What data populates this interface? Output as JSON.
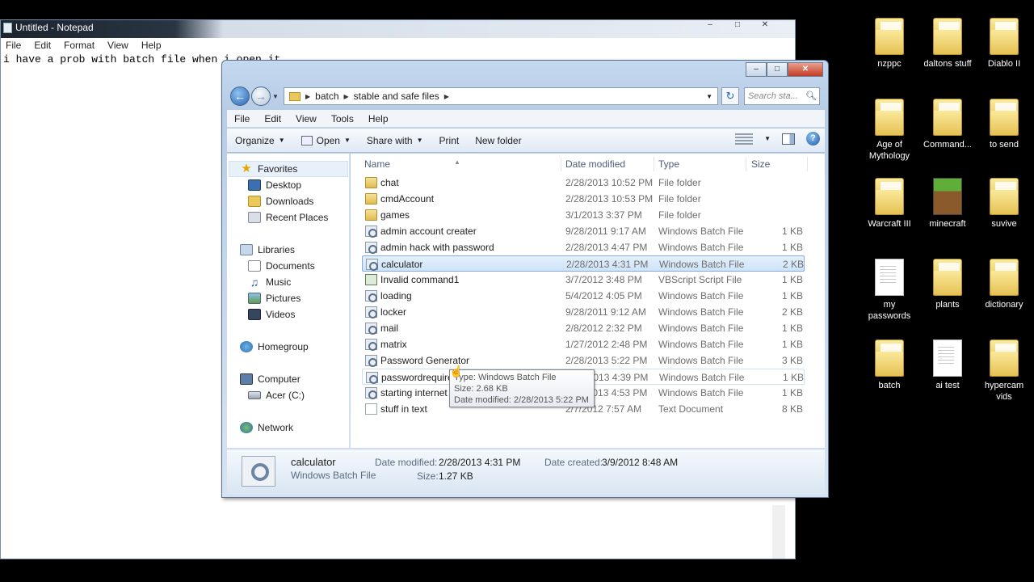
{
  "notepad": {
    "title": "Untitled - Notepad",
    "menu": [
      "File",
      "Edit",
      "Format",
      "View",
      "Help"
    ],
    "text": "i have a prob with batch file when i open it"
  },
  "explorer": {
    "address": {
      "crumbs": [
        "batch",
        "stable and safe files"
      ]
    },
    "search_placeholder": "Search sta...",
    "menu": [
      "File",
      "Edit",
      "View",
      "Tools",
      "Help"
    ],
    "toolbar": {
      "organize": "Organize",
      "open": "Open",
      "share": "Share with",
      "print": "Print",
      "new_folder": "New folder"
    },
    "nav": {
      "favorites": "Favorites",
      "desktop": "Desktop",
      "downloads": "Downloads",
      "recent": "Recent Places",
      "libraries": "Libraries",
      "documents": "Documents",
      "music": "Music",
      "pictures": "Pictures",
      "videos": "Videos",
      "homegroup": "Homegroup",
      "computer": "Computer",
      "acer": "Acer (C:)",
      "network": "Network"
    },
    "columns": {
      "name": "Name",
      "date": "Date modified",
      "type": "Type",
      "size": "Size"
    },
    "files": [
      {
        "name": "chat",
        "date": "2/28/2013 10:52 PM",
        "type": "File folder",
        "size": "",
        "kind": "folder"
      },
      {
        "name": "cmdAccount",
        "date": "2/28/2013 10:53 PM",
        "type": "File folder",
        "size": "",
        "kind": "folder"
      },
      {
        "name": "games",
        "date": "3/1/2013 3:37 PM",
        "type": "File folder",
        "size": "",
        "kind": "folder"
      },
      {
        "name": "admin account creater",
        "date": "9/28/2011 9:17 AM",
        "type": "Windows Batch File",
        "size": "1 KB",
        "kind": "bat"
      },
      {
        "name": "admin hack with password",
        "date": "2/28/2013 4:47 PM",
        "type": "Windows Batch File",
        "size": "1 KB",
        "kind": "bat"
      },
      {
        "name": "calculator",
        "date": "2/28/2013 4:31 PM",
        "type": "Windows Batch File",
        "size": "2 KB",
        "kind": "bat"
      },
      {
        "name": "Invalid command1",
        "date": "3/7/2012 3:48 PM",
        "type": "VBScript Script File",
        "size": "1 KB",
        "kind": "vbs"
      },
      {
        "name": "loading",
        "date": "5/4/2012 4:05 PM",
        "type": "Windows Batch File",
        "size": "1 KB",
        "kind": "bat"
      },
      {
        "name": "locker",
        "date": "9/28/2011 9:12 AM",
        "type": "Windows Batch File",
        "size": "2 KB",
        "kind": "bat"
      },
      {
        "name": "mail",
        "date": "2/8/2012 2:32 PM",
        "type": "Windows Batch File",
        "size": "1 KB",
        "kind": "bat"
      },
      {
        "name": "matrix",
        "date": "1/27/2012 2:48 PM",
        "type": "Windows Batch File",
        "size": "1 KB",
        "kind": "bat"
      },
      {
        "name": "Password Generator",
        "date": "2/28/2013 5:22 PM",
        "type": "Windows Batch File",
        "size": "3 KB",
        "kind": "bat"
      },
      {
        "name": "passwordrequire",
        "date": "2/28/2013 4:39 PM",
        "type": "Windows Batch File",
        "size": "1 KB",
        "kind": "bat"
      },
      {
        "name": "starting internet",
        "date": "2/28/2013 4:53 PM",
        "type": "Windows Batch File",
        "size": "1 KB",
        "kind": "bat"
      },
      {
        "name": "stuff in text",
        "date": "2/7/2012 7:57 AM",
        "type": "Text Document",
        "size": "8 KB",
        "kind": "txt"
      }
    ],
    "tooltip": {
      "type": "Type: Windows Batch File",
      "size": "Size: 2.68 KB",
      "modified": "Date modified: 2/28/2013 5:22 PM"
    },
    "details": {
      "name": "calculator",
      "type": "Windows Batch File",
      "modified_label": "Date modified:",
      "modified": "2/28/2013 4:31 PM",
      "size_label": "Size:",
      "size": "1.27 KB",
      "created_label": "Date created:",
      "created": "3/9/2012 8:48 AM"
    }
  },
  "desktop_icons": [
    {
      "label": "nzppc",
      "icon": "folder"
    },
    {
      "label": "daltons stuff",
      "icon": "folder"
    },
    {
      "label": "Diablo II",
      "icon": "folder"
    },
    {
      "label": "Age of Mythology",
      "icon": "folder"
    },
    {
      "label": "Command...",
      "icon": "folder"
    },
    {
      "label": "to send",
      "icon": "folder"
    },
    {
      "label": "Warcraft III",
      "icon": "folder"
    },
    {
      "label": "minecraft",
      "icon": "minecraft"
    },
    {
      "label": "suvive",
      "icon": "folder"
    },
    {
      "label": "my passwords",
      "icon": "document"
    },
    {
      "label": "plants",
      "icon": "folder"
    },
    {
      "label": "dictionary",
      "icon": "folder"
    },
    {
      "label": "batch",
      "icon": "folder"
    },
    {
      "label": "ai test",
      "icon": "document"
    },
    {
      "label": "hypercam vids",
      "icon": "folder"
    }
  ],
  "colors": {
    "selection": "#cfe3f8",
    "titlebar": "#c4d9ef",
    "close": "#c63b24"
  }
}
